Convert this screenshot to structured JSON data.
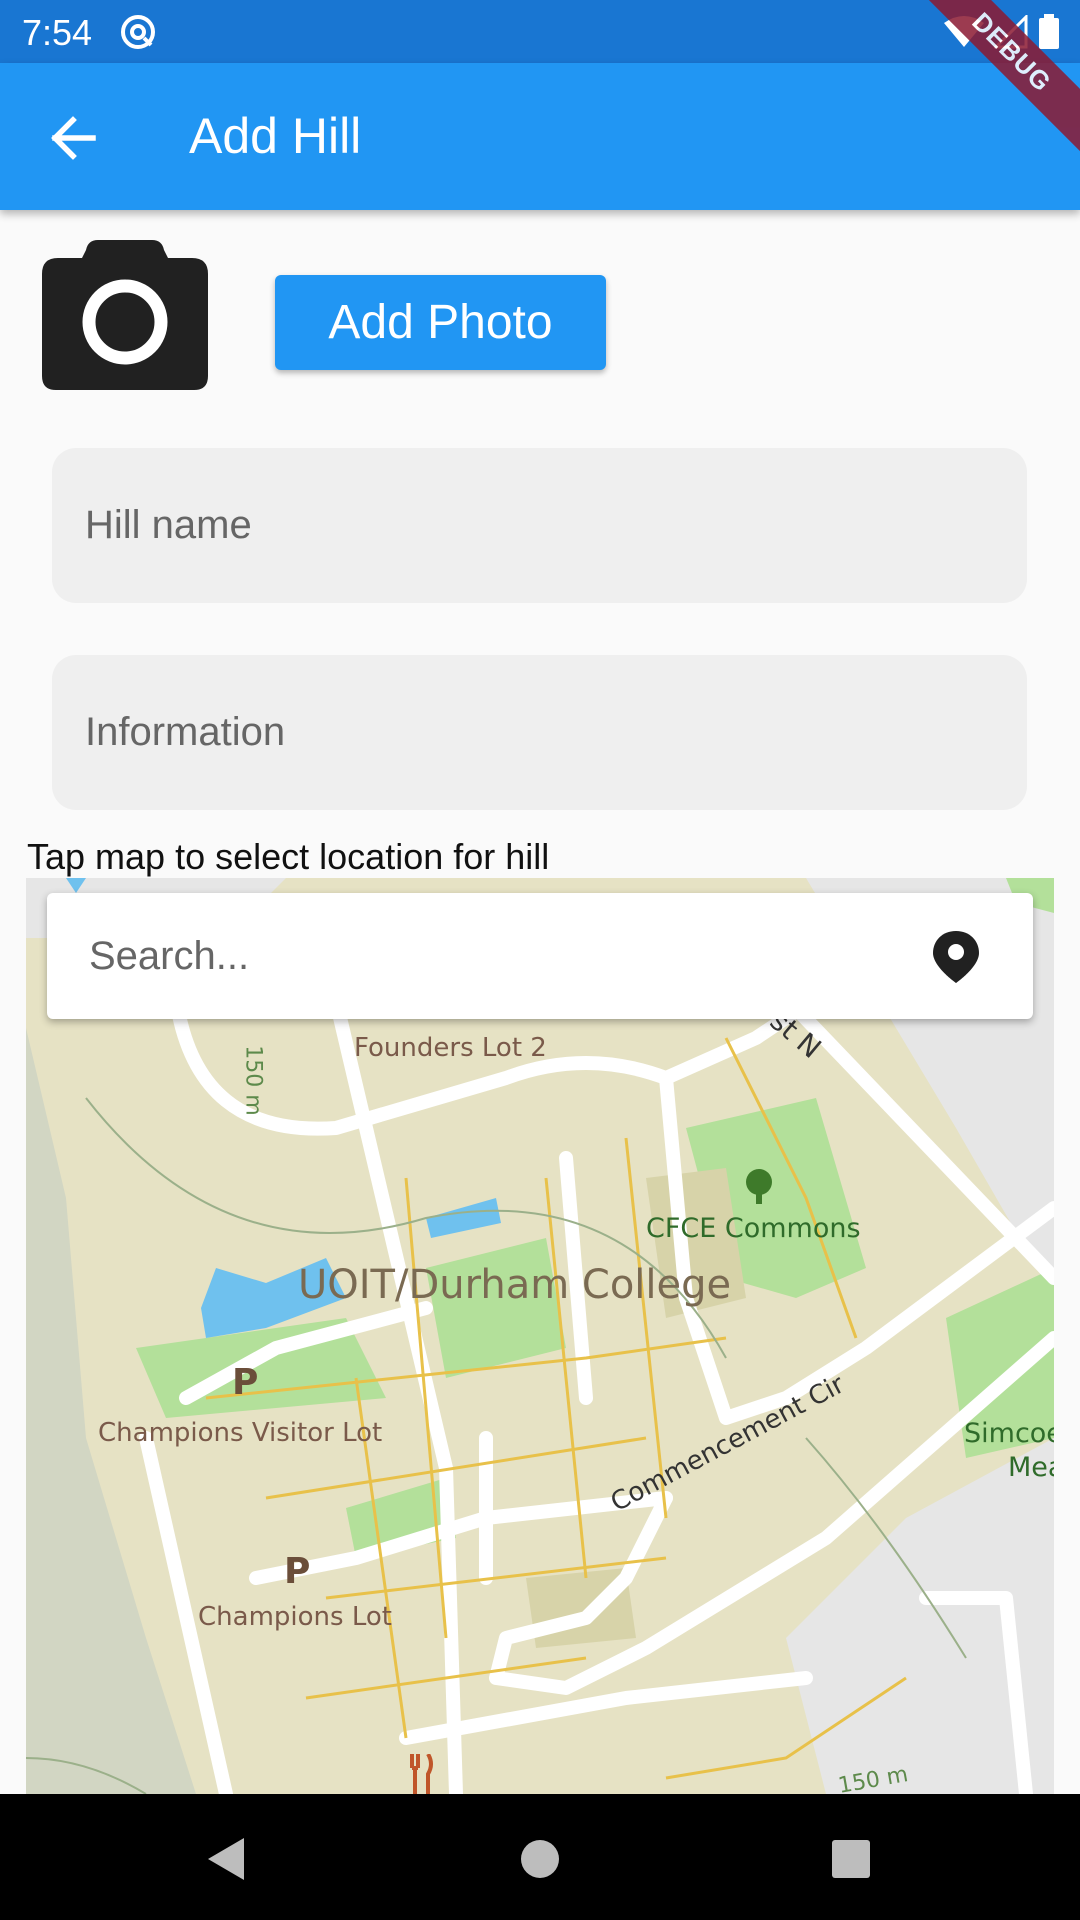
{
  "status_bar": {
    "time": "7:54"
  },
  "debug_banner": "DEBUG",
  "app_bar": {
    "title": "Add Hill"
  },
  "photo": {
    "add_photo_label": "Add Photo"
  },
  "form": {
    "hill_name_placeholder": "Hill name",
    "hill_name_value": "",
    "information_placeholder": "Information",
    "information_value": ""
  },
  "map_caption": "Tap map to select location for hill",
  "search": {
    "placeholder": "Search...",
    "value": ""
  },
  "map": {
    "labels": {
      "founders_lot": "Founders Lot 2",
      "contour_150_left": "150 m",
      "cfce_commons": "CFCE Commons",
      "campus": "UOIT/Durham College",
      "champions_visitor_lot": "Champions Visitor Lot",
      "champions_lot": "Champions Lot",
      "commencement_cir": "Commencement Cir",
      "simcoe_1": "Simcoe",
      "simcoe_2": "Mea",
      "street_n": "st N",
      "contour_150_bottom": "150 m",
      "parking_1": "P",
      "parking_2": "P"
    },
    "colors": {
      "campus": "#e6e2c4",
      "park": "#b3e09a",
      "water": "#6fc1ee",
      "road": "#ffffff",
      "path": "#e8c14a",
      "outside": "#e6e6e6"
    }
  },
  "colors": {
    "status_bar": "#1976d2",
    "app_bar": "#2196f3",
    "button": "#2196f3"
  }
}
